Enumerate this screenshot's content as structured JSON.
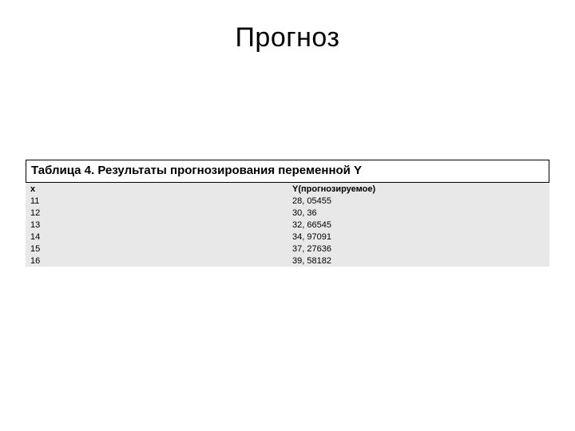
{
  "title": "Прогноз",
  "table": {
    "caption": "Таблица 4. Результаты прогнозирования переменной Y",
    "headers": {
      "x": "x",
      "y": "Y(прогнозируемое)"
    },
    "rows": [
      {
        "x": "11",
        "y": "28, 05455"
      },
      {
        "x": "12",
        "y": "30, 36"
      },
      {
        "x": "13",
        "y": "32, 66545"
      },
      {
        "x": "14",
        "y": "34, 97091"
      },
      {
        "x": "15",
        "y": "37, 27636"
      },
      {
        "x": "16",
        "y": "39, 58182"
      }
    ]
  }
}
